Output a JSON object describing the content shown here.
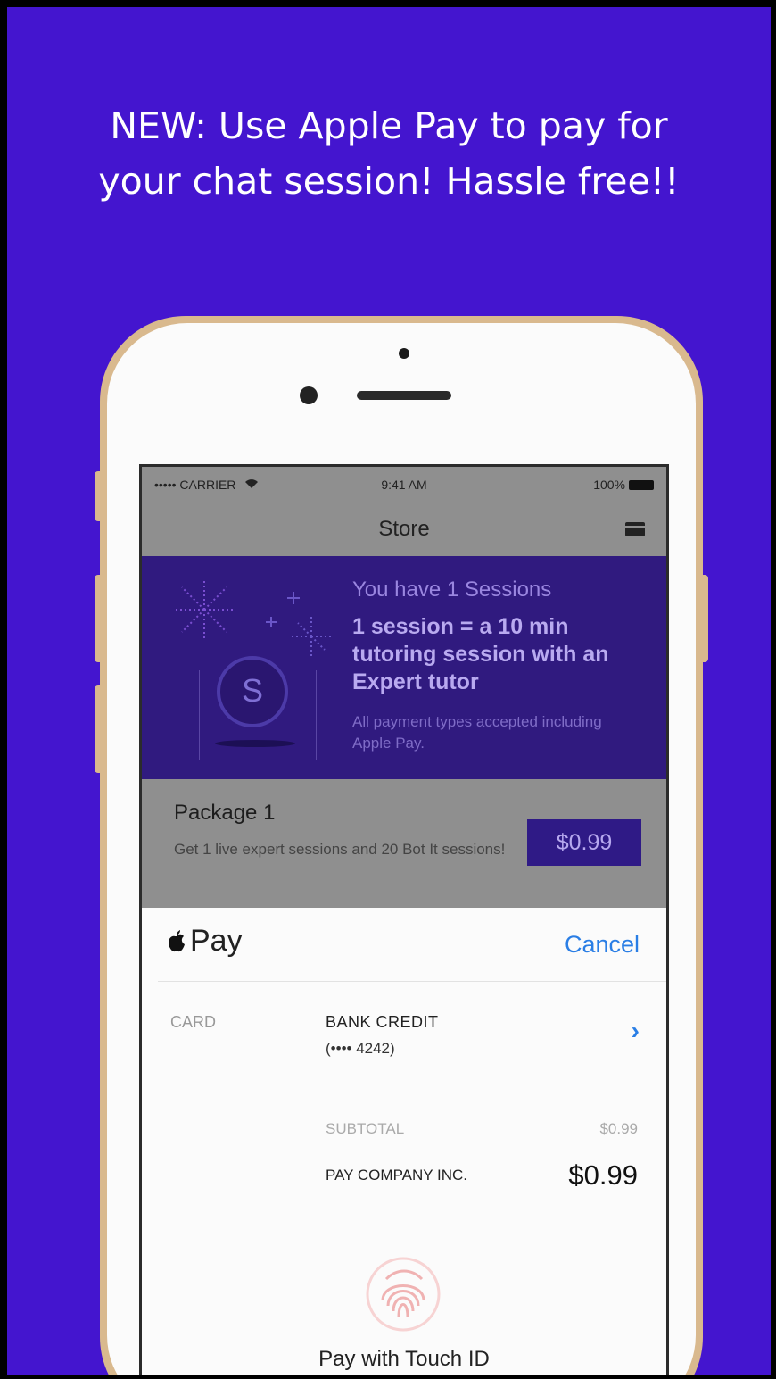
{
  "headline": {
    "line1": "NEW: Use Apple Pay to pay for",
    "line2": "your chat session! Hassle free!!"
  },
  "status_bar": {
    "carrier": "••••• CARRIER",
    "time": "9:41 AM",
    "battery": "100%"
  },
  "nav": {
    "title": "Store"
  },
  "banner": {
    "sessions_count": "You have 1 Sessions",
    "description": "1 session = a 10 min tutoring session with an Expert tutor",
    "note": "All payment types accepted including Apple Pay.",
    "coin_letter": "S"
  },
  "package": {
    "name": "Package 1",
    "description": "Get 1 live expert sessions and 20 Bot It sessions!",
    "price": "$0.99"
  },
  "apple_pay": {
    "brand": "Pay",
    "cancel_label": "Cancel",
    "card_label": "CARD",
    "card_name": "BANK  CREDIT",
    "card_number": "(•••• 4242)",
    "subtotal_label": "SUBTOTAL",
    "subtotal_value": "$0.99",
    "company": "PAY COMPANY INC.",
    "total": "$0.99",
    "touch_id_label": "Pay with Touch ID"
  },
  "colors": {
    "background": "#4415cf",
    "banner": "#301a7f",
    "link_blue": "#2a7ee5",
    "phone_gold": "#d9b98e"
  }
}
